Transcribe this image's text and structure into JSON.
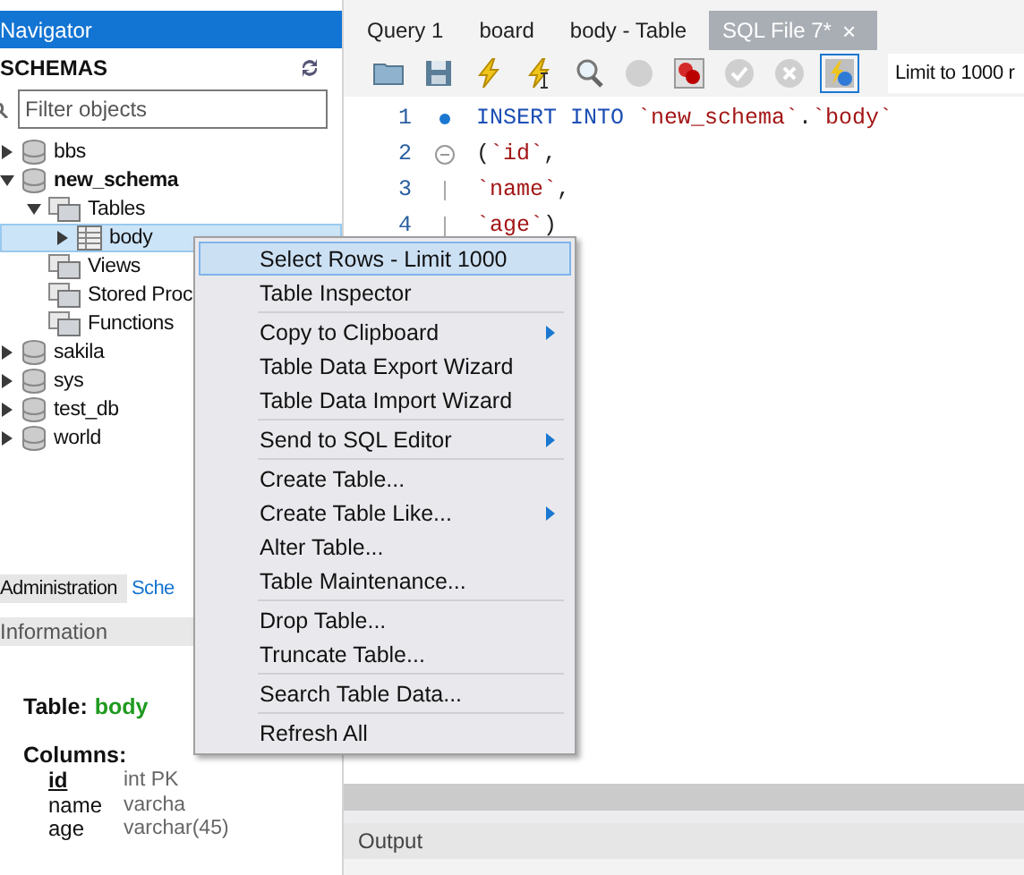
{
  "navigator": {
    "title": "Navigator",
    "section": "SCHEMAS",
    "filter": {
      "placeholder": "Filter objects"
    },
    "tree": [
      {
        "label": "bbs",
        "kind": "schema",
        "expanded": false,
        "selected": false,
        "active": false
      },
      {
        "label": "new_schema",
        "kind": "schema",
        "expanded": true,
        "selected": false,
        "active": true,
        "children": [
          {
            "label": "Tables",
            "kind": "folder",
            "expanded": true,
            "selected": false,
            "active": false,
            "children": [
              {
                "label": "body",
                "kind": "table",
                "expanded": false,
                "selected": true,
                "active": false
              }
            ]
          },
          {
            "label": "Views",
            "kind": "folder",
            "selected": false,
            "active": false
          },
          {
            "label": "Stored Proc",
            "kind": "folder",
            "selected": false,
            "active": false
          },
          {
            "label": "Functions",
            "kind": "folder",
            "selected": false,
            "active": false
          }
        ]
      },
      {
        "label": "sakila",
        "kind": "schema",
        "expanded": false,
        "selected": false,
        "active": false
      },
      {
        "label": "sys",
        "kind": "schema",
        "expanded": false,
        "selected": false,
        "active": false
      },
      {
        "label": "test_db",
        "kind": "schema",
        "expanded": false,
        "selected": false,
        "active": false
      },
      {
        "label": "world",
        "kind": "schema",
        "expanded": false,
        "selected": false,
        "active": false
      }
    ]
  },
  "bottom_tabs": [
    {
      "label": "Administration",
      "selected": false
    },
    {
      "label": "Sche",
      "selected": true
    }
  ],
  "information": {
    "title": "Information",
    "table_label": "Table:",
    "table_name": "body",
    "columns_label": "Columns:",
    "columns": [
      {
        "name": "id",
        "type": "int PK",
        "key": true
      },
      {
        "name": "name",
        "type": "varcha",
        "key": false
      },
      {
        "name": "age",
        "type": "varchar(45)",
        "key": false
      }
    ]
  },
  "editor_tabs": [
    {
      "label": "Query 1",
      "selected": false
    },
    {
      "label": "board",
      "selected": false
    },
    {
      "label": "body - Table",
      "selected": false
    },
    {
      "label": "SQL File 7*",
      "selected": true,
      "close": "×"
    }
  ],
  "toolbar": {
    "buttons": [
      {
        "kind": "folder",
        "selected": false
      },
      {
        "kind": "save",
        "selected": false
      },
      {
        "kind": "execute",
        "selected": false
      },
      {
        "kind": "execute-line",
        "selected": false
      },
      {
        "kind": "explain",
        "selected": false
      },
      {
        "kind": "stop",
        "selected": false
      },
      {
        "kind": "stop-on-error",
        "selected": false
      },
      {
        "kind": "commit",
        "selected": false
      },
      {
        "kind": "rollback",
        "selected": false
      },
      {
        "kind": "autocommit",
        "selected": true
      }
    ],
    "limit": "Limit to 1000 r"
  },
  "code": [
    {
      "number": "1",
      "marker": true,
      "fold": false,
      "tokens": [
        {
          "kind": "keyword",
          "text": "INSERT INTO "
        },
        {
          "kind": "ident",
          "text": "`new_schema`"
        },
        {
          "kind": "punct",
          "text": "."
        },
        {
          "kind": "ident",
          "text": "`body`"
        }
      ]
    },
    {
      "number": "2",
      "marker": false,
      "fold": true,
      "tokens": [
        {
          "kind": "punct",
          "text": "("
        },
        {
          "kind": "ident",
          "text": "`id`"
        },
        {
          "kind": "punct",
          "text": ","
        }
      ]
    },
    {
      "number": "3",
      "marker": false,
      "fold": false,
      "tokens": [
        {
          "kind": "ident",
          "text": "`name`"
        },
        {
          "kind": "punct",
          "text": ","
        }
      ]
    },
    {
      "number": "4",
      "marker": false,
      "fold": false,
      "tokens": [
        {
          "kind": "ident",
          "text": "`age`"
        },
        {
          "kind": "punct",
          "text": ")"
        }
      ]
    }
  ],
  "output": {
    "title": "Output"
  },
  "context_menu": [
    [
      {
        "label": "Select Rows - Limit 1000",
        "selected": true,
        "submenu": false
      },
      {
        "label": "Table Inspector",
        "selected": false,
        "submenu": false
      }
    ],
    [
      {
        "label": "Copy to Clipboard",
        "selected": false,
        "submenu": true
      },
      {
        "label": "Table Data Export Wizard",
        "selected": false,
        "submenu": false
      },
      {
        "label": "Table Data Import Wizard",
        "selected": false,
        "submenu": false
      }
    ],
    [
      {
        "label": "Send to SQL Editor",
        "selected": false,
        "submenu": true
      }
    ],
    [
      {
        "label": "Create Table...",
        "selected": false,
        "submenu": false
      },
      {
        "label": "Create Table Like...",
        "selected": false,
        "submenu": true
      },
      {
        "label": "Alter Table...",
        "selected": false,
        "submenu": false
      },
      {
        "label": "Table Maintenance...",
        "selected": false,
        "submenu": false
      }
    ],
    [
      {
        "label": "Drop Table...",
        "selected": false,
        "submenu": false
      },
      {
        "label": "Truncate Table...",
        "selected": false,
        "submenu": false
      }
    ],
    [
      {
        "label": "Search Table Data...",
        "selected": false,
        "submenu": false
      }
    ],
    [
      {
        "label": "Refresh All",
        "selected": false,
        "submenu": false
      }
    ]
  ]
}
